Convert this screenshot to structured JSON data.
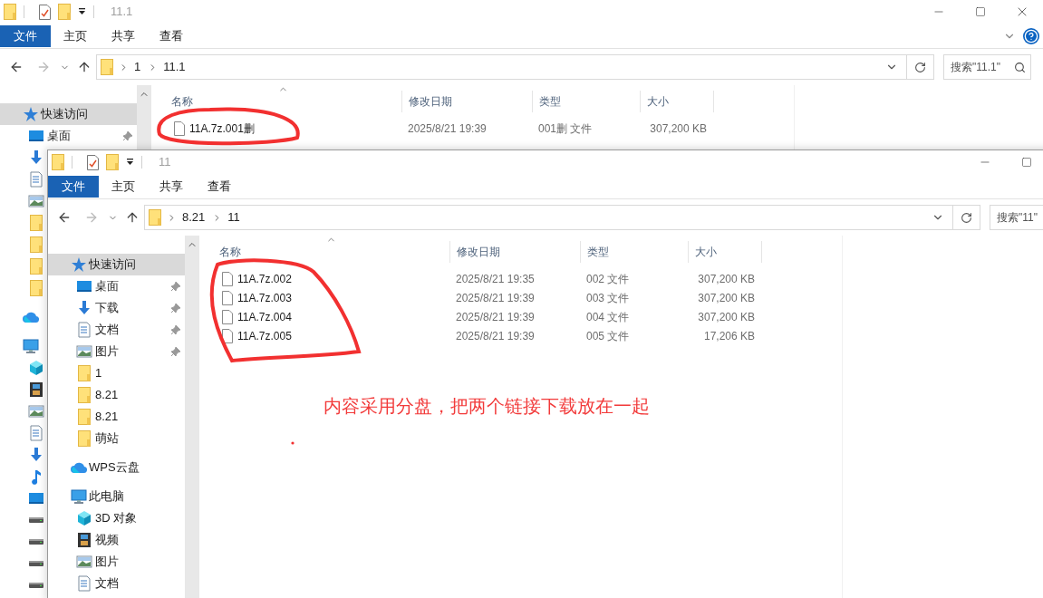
{
  "windows": [
    {
      "title": "11.1",
      "caption_buttons": [
        {
          "kind": "minimize"
        },
        {
          "kind": "maximize"
        },
        {
          "kind": "close"
        }
      ],
      "ribbon_tabs": [
        {
          "label": "文件",
          "selected": true
        },
        {
          "label": "主页",
          "selected": false
        },
        {
          "label": "共享",
          "selected": false
        },
        {
          "label": "查看",
          "selected": false
        }
      ],
      "ribbon_help": true,
      "address": {
        "segments": [
          "1",
          "11.1"
        ]
      },
      "search": {
        "placeholder": "搜索\"11.1\""
      },
      "nav": [
        {
          "label": "快速访问",
          "kind": "quick",
          "selected": true,
          "pinned": false,
          "children": [
            {
              "label": "桌面",
              "kind": "desktop",
              "selected": false,
              "pinned": true
            },
            {
              "kind": "download"
            },
            {
              "kind": "doc"
            },
            {
              "kind": "picture"
            },
            {
              "kind": "folder"
            },
            {
              "kind": "folder"
            },
            {
              "kind": "folder"
            },
            {
              "kind": "folder"
            }
          ]
        },
        {
          "kind": "cloud"
        },
        {
          "kind": "pc",
          "children": [
            {
              "kind": "cube"
            },
            {
              "kind": "film"
            },
            {
              "kind": "picture"
            },
            {
              "kind": "doc"
            },
            {
              "kind": "download"
            },
            {
              "kind": "music"
            },
            {
              "kind": "desktop"
            },
            {
              "kind": "drive"
            },
            {
              "kind": "drive"
            },
            {
              "kind": "drive"
            },
            {
              "kind": "drive"
            }
          ]
        }
      ],
      "columns": [
        "名称",
        "修改日期",
        "类型",
        "大小"
      ],
      "files": [
        {
          "name": "11A.7z.001删",
          "date": "2025/8/21 19:39",
          "type": "001删 文件",
          "size": "307,200 KB"
        }
      ]
    },
    {
      "title": "11",
      "caption_buttons": [
        {
          "kind": "minimize"
        },
        {
          "kind": "maximize"
        }
      ],
      "ribbon_tabs": [
        {
          "label": "文件",
          "selected": true
        },
        {
          "label": "主页",
          "selected": false
        },
        {
          "label": "共享",
          "selected": false
        },
        {
          "label": "查看",
          "selected": false
        }
      ],
      "ribbon_help": false,
      "address": {
        "segments": [
          "8.21",
          "11"
        ]
      },
      "search": {
        "placeholder": "搜索\"11\""
      },
      "nav": [
        {
          "label": "快速访问",
          "kind": "quick",
          "selected": true,
          "pinned": false,
          "children": [
            {
              "label": "桌面",
              "kind": "desktop",
              "selected": false,
              "pinned": true
            },
            {
              "label": "下载",
              "kind": "download",
              "selected": false,
              "pinned": true
            },
            {
              "label": "文档",
              "kind": "doc",
              "selected": false,
              "pinned": true
            },
            {
              "label": "图片",
              "kind": "picture",
              "selected": false,
              "pinned": true
            },
            {
              "label": "1",
              "kind": "folder",
              "selected": false,
              "pinned": false
            },
            {
              "label": "8.21",
              "kind": "folder",
              "selected": false,
              "pinned": false
            },
            {
              "label": "8.21",
              "kind": "folder",
              "selected": false,
              "pinned": false
            },
            {
              "label": "萌站",
              "kind": "folder",
              "selected": false,
              "pinned": false
            }
          ]
        },
        {
          "label": "WPS云盘",
          "kind": "cloud",
          "selected": false,
          "pinned": false
        },
        {
          "label": "此电脑",
          "kind": "pc",
          "selected": false,
          "pinned": false,
          "children": [
            {
              "label": "3D 对象",
              "kind": "cube",
              "selected": false,
              "pinned": false
            },
            {
              "label": "视频",
              "kind": "film",
              "selected": false,
              "pinned": false
            },
            {
              "label": "图片",
              "kind": "picture",
              "selected": false,
              "pinned": false
            },
            {
              "label": "文档",
              "kind": "doc",
              "selected": false,
              "pinned": false
            }
          ]
        }
      ],
      "columns": [
        "名称",
        "修改日期",
        "类型",
        "大小"
      ],
      "files": [
        {
          "name": "11A.7z.002",
          "date": "2025/8/21 19:35",
          "type": "002 文件",
          "size": "307,200 KB"
        },
        {
          "name": "11A.7z.003",
          "date": "2025/8/21 19:39",
          "type": "003 文件",
          "size": "307,200 KB"
        },
        {
          "name": "11A.7z.004",
          "date": "2025/8/21 19:39",
          "type": "004 文件",
          "size": "307,200 KB"
        },
        {
          "name": "11A.7z.005",
          "date": "2025/8/21 19:39",
          "type": "005 文件",
          "size": "17,206 KB"
        }
      ]
    }
  ],
  "annotation": {
    "note": "内容采用分盘，把两个链接下载放在一起"
  }
}
